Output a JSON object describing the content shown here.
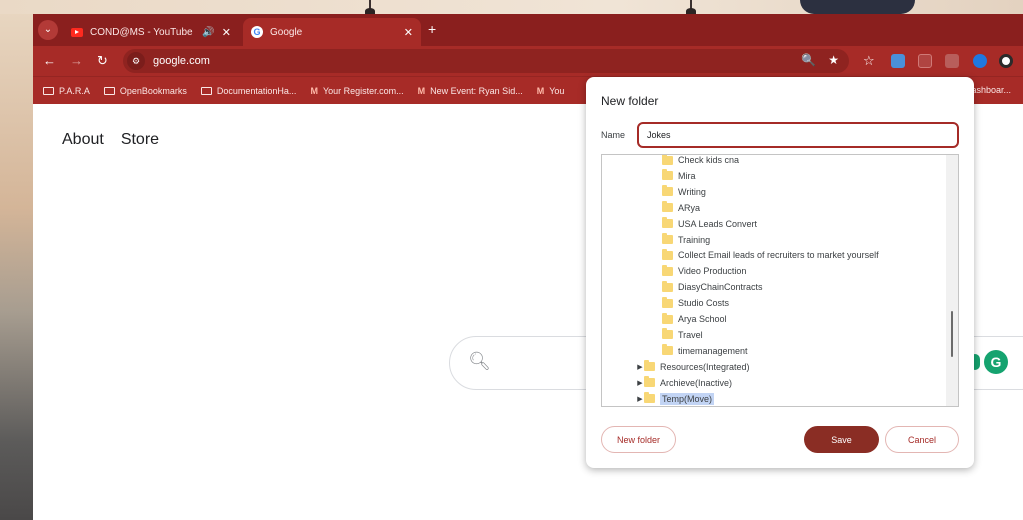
{
  "tabs": [
    {
      "title": "COND@MS - YouTube",
      "icon": "youtube-icon",
      "has_audio": true
    },
    {
      "title": "Google",
      "icon": "google-icon",
      "active": true
    }
  ],
  "toolbar": {
    "url": "google.com"
  },
  "bookmarks": [
    {
      "label": "P.A.R.A",
      "icon": "folder-icon"
    },
    {
      "label": "OpenBookmarks",
      "icon": "folder-icon"
    },
    {
      "label": "DocumentationHa...",
      "icon": "folder-icon"
    },
    {
      "label": "Your Register.com...",
      "icon": "gmail-icon"
    },
    {
      "label": "New Event: Ryan Sid...",
      "icon": "gmail-icon"
    },
    {
      "label": "You",
      "icon": "gmail-icon"
    }
  ],
  "bookmarks_right": "ashboar...",
  "google": {
    "about": "About",
    "store": "Store"
  },
  "dialog": {
    "title": "New folder",
    "name_label": "Name",
    "name_value": "Jokes",
    "folders": [
      {
        "label": "Check kids cna",
        "level": 2
      },
      {
        "label": "Mira",
        "level": 2
      },
      {
        "label": "Writing",
        "level": 2
      },
      {
        "label": "ARya",
        "level": 2
      },
      {
        "label": "USA Leads Convert",
        "level": 2
      },
      {
        "label": "Training",
        "level": 2
      },
      {
        "label": "Collect Email leads of recruiters to market yourself",
        "level": 2
      },
      {
        "label": "Video Production",
        "level": 2
      },
      {
        "label": "DiasyChainContracts",
        "level": 2
      },
      {
        "label": "Studio Costs",
        "level": 2
      },
      {
        "label": "Arya School",
        "level": 2
      },
      {
        "label": "Travel",
        "level": 2
      },
      {
        "label": "timemanagement",
        "level": 2
      },
      {
        "label": "Resources(Integrated)",
        "level": 1,
        "expandable": true
      },
      {
        "label": "Archieve(Inactive)",
        "level": 1,
        "expandable": true
      },
      {
        "label": "Temp(Move)",
        "level": 1,
        "expandable": true,
        "selected": true
      }
    ],
    "new_folder_label": "New folder",
    "save_label": "Save",
    "cancel_label": "Cancel"
  },
  "colors": {
    "theme": "#a72b27",
    "tabbar": "#8a1f1e",
    "save_button": "#8a2d24"
  }
}
